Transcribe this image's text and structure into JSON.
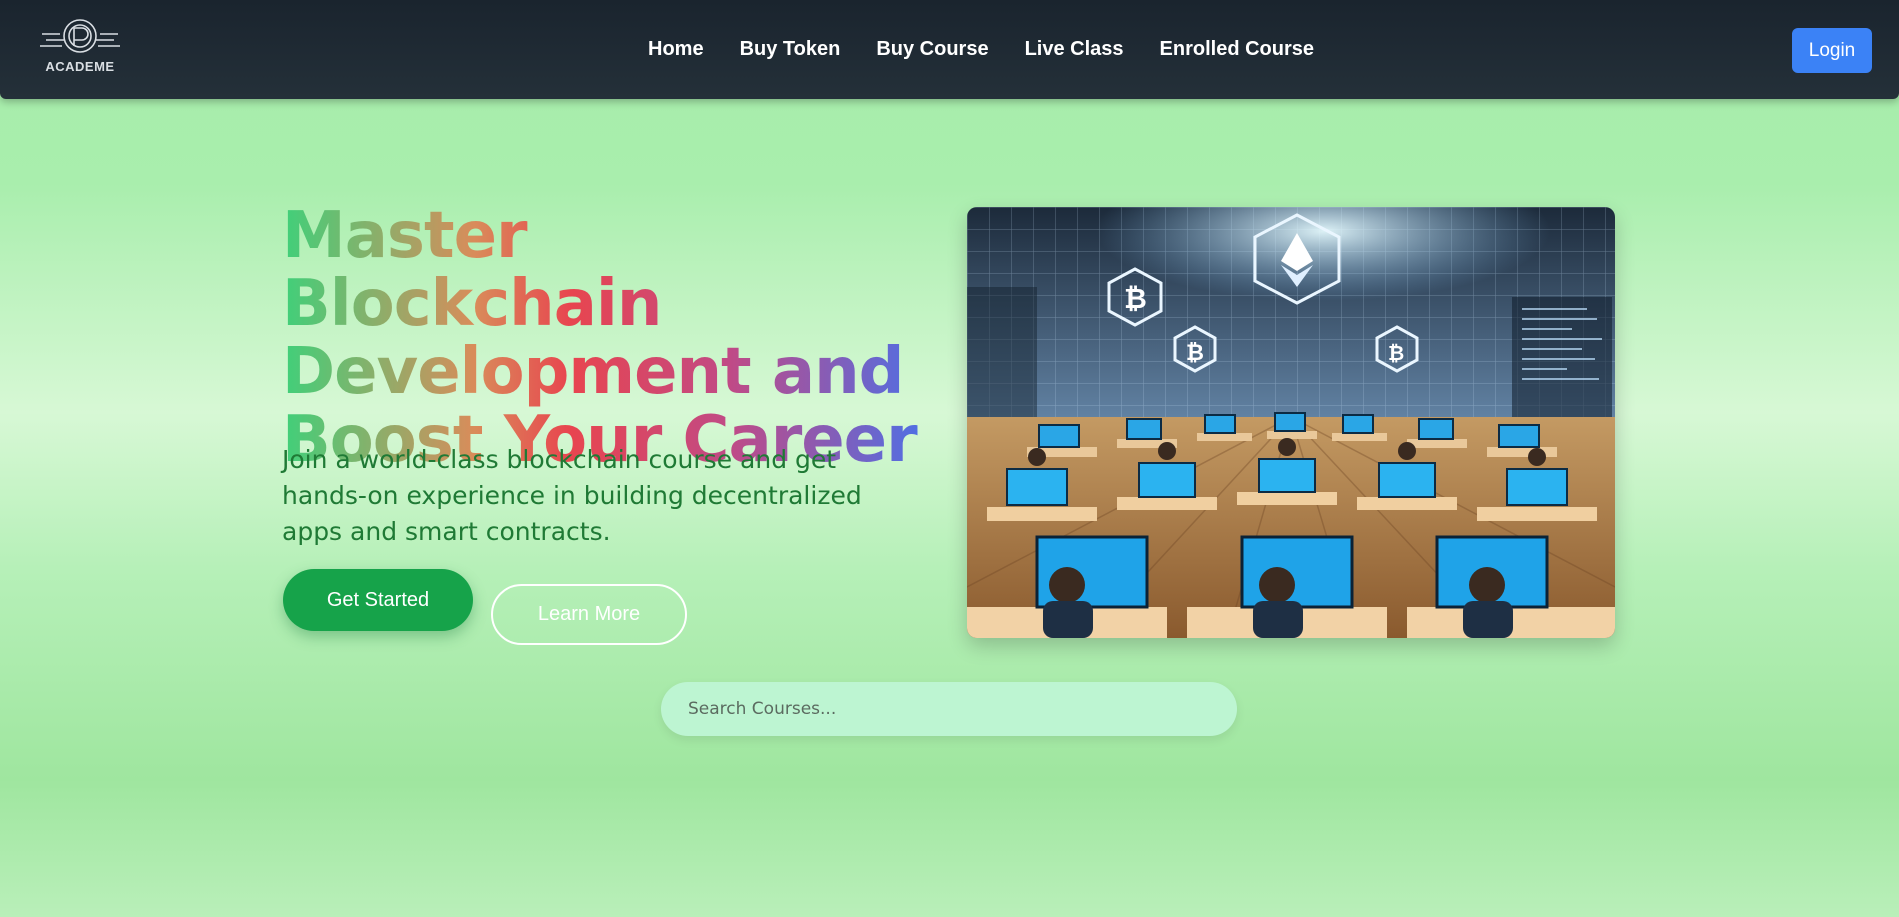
{
  "brand": {
    "name": "ACADEME",
    "logo_icon": "fingerprint-logo-icon"
  },
  "nav": {
    "links": [
      "Home",
      "Buy Token",
      "Buy Course",
      "Live Class",
      "Enrolled Course"
    ],
    "login_label": "Login"
  },
  "hero": {
    "title_lines": [
      "Master Blockchain",
      "Development and",
      "Boost Your Career"
    ],
    "subtitle": "Join a world-class blockchain course and get hands-on experience in building decentralized apps and smart contracts.",
    "primary_button": "Get Started",
    "secondary_button": "Learn More",
    "image_icon": "blockchain-classroom-illustration"
  },
  "search": {
    "placeholder": "Search Courses..."
  },
  "colors": {
    "nav_bg": "#1a242e",
    "login_bg": "#3b82f6",
    "primary_green": "#16a34a",
    "subtitle_green": "#1f7a35",
    "search_bg": "#bdf5d2"
  }
}
